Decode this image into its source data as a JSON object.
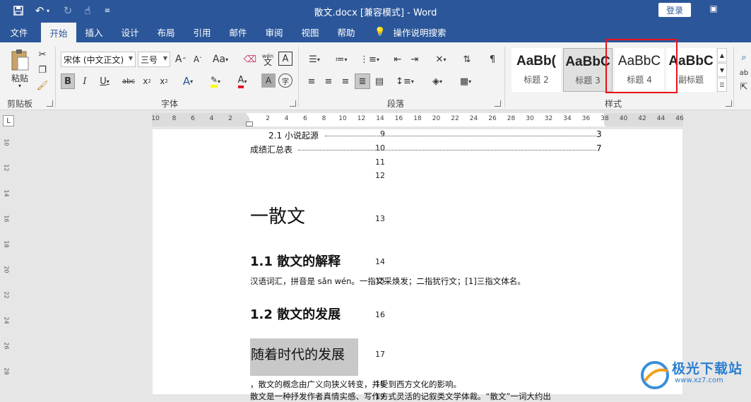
{
  "window": {
    "title": "散文.docx [兼容模式] - Word",
    "login_label": "登录"
  },
  "quick_access": {
    "save": "save-icon",
    "undo": "undo-icon",
    "redo": "redo-icon",
    "touch": "touch-mode-icon",
    "customize": "customize-icon"
  },
  "menu": {
    "tabs": [
      "文件",
      "开始",
      "插入",
      "设计",
      "布局",
      "引用",
      "邮件",
      "审阅",
      "视图",
      "帮助",
      "操作说明搜索"
    ],
    "active": "开始"
  },
  "ribbon": {
    "groups": {
      "clipboard": "剪贴板",
      "font": "字体",
      "paragraph": "段落",
      "styles": "样式"
    },
    "paste_label": "粘贴",
    "font_name": "宋体 (中文正文)",
    "font_size": "三号",
    "aa_label": "Aa",
    "wen_label": "wén",
    "styles": [
      {
        "preview": "AaBb(",
        "name": "标题 2"
      },
      {
        "preview": "AaBbC",
        "name": "标题 3"
      },
      {
        "preview": "AaBbC",
        "name": "标题 4"
      },
      {
        "preview": "AaBbC",
        "name": "副标题"
      }
    ]
  },
  "ruler": {
    "numbers": [
      "10",
      "8",
      "6",
      "4",
      "2",
      "2",
      "4",
      "6",
      "8",
      "10",
      "12",
      "14",
      "16",
      "18",
      "20",
      "22",
      "24",
      "26",
      "28",
      "30",
      "32",
      "34",
      "36",
      "38",
      "40",
      "42",
      "44",
      "46"
    ]
  },
  "vruler": {
    "numbers": [
      "10",
      "12",
      "14",
      "16",
      "18",
      "20",
      "22",
      "24",
      "26",
      "28"
    ]
  },
  "document": {
    "lines": [
      {
        "num": "9",
        "text": "2.1 小说起源",
        "page": "3"
      },
      {
        "num": "10",
        "text": "成绩汇总表",
        "page": "7"
      },
      {
        "num": "11",
        "text": ""
      },
      {
        "num": "12",
        "text": ""
      },
      {
        "num": "13",
        "text": "一散文"
      },
      {
        "num": "14",
        "text": "1.1 散文的解释"
      },
      {
        "num": "15",
        "text": "汉语词汇，拼音是 sǎn wén。一指文采焕发；二指犹行文；[1]三指文体名。"
      },
      {
        "num": "16",
        "text": "1.2 散文的发展"
      },
      {
        "num": "17",
        "text": "随着时代的发展"
      },
      {
        "num": "18",
        "text": "，散文的概念由广义向狭义转变，并受到西方文化的影响。"
      },
      {
        "num": "19",
        "text": "散文是一种抒发作者真情实感、写作方式灵活的记叙类文学体裁。“散文”一词大约出"
      }
    ]
  },
  "watermark": {
    "text": "极光下载站",
    "url": "www.xz7.com"
  }
}
